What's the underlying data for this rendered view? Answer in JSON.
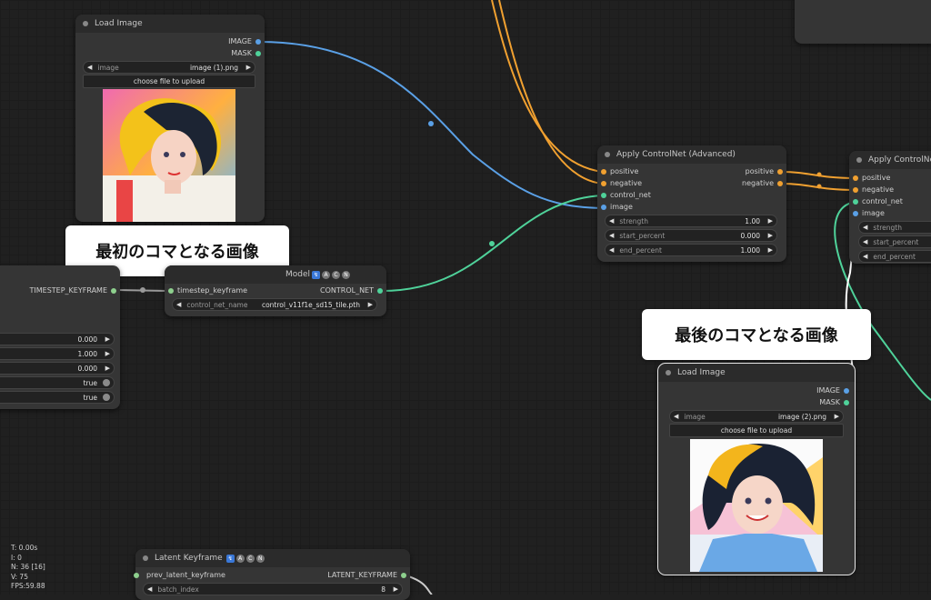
{
  "nodes": {
    "load_image_1": {
      "title": "Load Image",
      "out_image": "IMAGE",
      "out_mask": "MASK",
      "image_label": "image",
      "image_value": "image (1).png",
      "upload_label": "choose file to upload"
    },
    "controlnet_loader": {
      "title_fragment": "Model",
      "in_label": "timestep_keyframe",
      "out_label": "CONTROL_NET",
      "cn_label": "control_net_name",
      "cn_value": "control_v11f1e_sd15_tile.pth"
    },
    "timestep_keyframe": {
      "out_label": "TIMESTEP_KEYFRAME",
      "rows": [
        "0.000",
        "1.000",
        "0.000",
        "true",
        "true"
      ]
    },
    "apply_cn_1": {
      "title": "Apply ControlNet (Advanced)",
      "inputs": [
        "positive",
        "negative",
        "control_net",
        "image"
      ],
      "outputs": [
        "positive",
        "negative"
      ],
      "strength_label": "strength",
      "strength_value": "1.00",
      "start_label": "start_percent",
      "start_value": "0.000",
      "end_label": "end_percent",
      "end_value": "1.000"
    },
    "apply_cn_2": {
      "title": "Apply ControlNet",
      "inputs": [
        "positive",
        "negative",
        "control_net",
        "image"
      ],
      "strength_label": "strength",
      "start_label": "start_percent",
      "end_label": "end_percent"
    },
    "load_image_2": {
      "title": "Load Image",
      "out_image": "IMAGE",
      "out_mask": "MASK",
      "image_label": "image",
      "image_value": "image (2).png",
      "upload_label": "choose file to upload"
    },
    "latent_keyframe": {
      "title": "Latent Keyframe",
      "in_label": "prev_latent_keyframe",
      "out_label": "LATENT_KEYFRAME",
      "batch_label": "batch_index",
      "batch_value": "8"
    }
  },
  "callouts": {
    "first": "最初のコマとなる画像",
    "last": "最後のコマとなる画像"
  },
  "stats": {
    "t": "T: 0.00s",
    "i": "I: 0",
    "n": "N: 36 [16]",
    "v": "V: 75",
    "fps": "FPS:59.88"
  },
  "colors": {
    "image_wire": "#5aa0e6",
    "conditioning_wire": "#f0a030",
    "controlnet_wire": "#4fd29a",
    "node_bg": "#353535",
    "canvas_bg": "#202020"
  }
}
